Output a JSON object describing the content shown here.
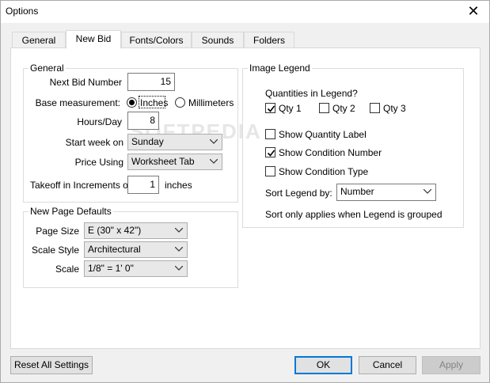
{
  "window": {
    "title": "Options"
  },
  "tabs": [
    "General",
    "New Bid",
    "Fonts/Colors",
    "Sounds",
    "Folders"
  ],
  "active_tab": "New Bid",
  "general": {
    "title": "General",
    "next_bid_label": "Next Bid Number",
    "next_bid_value": "15",
    "base_label": "Base measurement:",
    "inches_label": "Inches",
    "millimeters_label": "Millimeters",
    "base_selected": "Inches",
    "hours_label": "Hours/Day",
    "hours_value": "8",
    "start_week_label": "Start week on",
    "start_week_value": "Sunday",
    "price_label": "Price Using",
    "price_value": "Worksheet Tab",
    "takeoff_label": "Takeoff in Increments of",
    "takeoff_value": "1",
    "takeoff_unit": "inches"
  },
  "page_defaults": {
    "title": "New Page Defaults",
    "page_size_label": "Page Size",
    "page_size_value": "E (30\" x 42\")",
    "scale_style_label": "Scale Style",
    "scale_style_value": "Architectural",
    "scale_label": "Scale",
    "scale_value": "1/8\" = 1' 0\""
  },
  "legend": {
    "title": "Image Legend",
    "quantities_label": "Quantities in Legend?",
    "qty1": {
      "label": "Qty 1",
      "checked": true
    },
    "qty2": {
      "label": "Qty 2",
      "checked": false
    },
    "qty3": {
      "label": "Qty 3",
      "checked": false
    },
    "show_quantity_label": {
      "label": "Show Quantity Label",
      "checked": false
    },
    "show_condition_number": {
      "label": "Show Condition Number",
      "checked": true
    },
    "show_condition_type": {
      "label": "Show Condition Type",
      "checked": false
    },
    "sort_label": "Sort Legend by:",
    "sort_value": "Number",
    "sort_note": "Sort only applies when Legend is grouped"
  },
  "buttons": {
    "reset": "Reset All Settings",
    "ok": "OK",
    "cancel": "Cancel",
    "apply": "Apply"
  },
  "watermark": "SOFTPEDIA"
}
